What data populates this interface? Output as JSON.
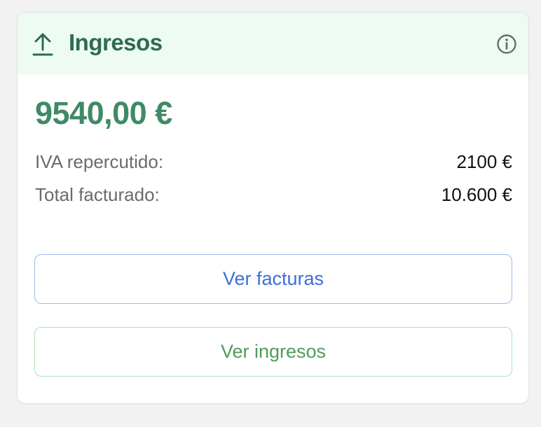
{
  "card": {
    "title": "Ingresos",
    "header_icon": "upload-icon",
    "info_icon": "info-icon",
    "net_amount": "9540,00 €",
    "rows": [
      {
        "label": "IVA repercutido:",
        "value": "2100 €"
      },
      {
        "label": "Total facturado:",
        "value": "10.600 €"
      }
    ],
    "buttons": {
      "view_invoices": "Ver facturas",
      "view_income": "Ver ingresos"
    }
  },
  "colors": {
    "header_background": "#edfbf2",
    "title": "#2f6b4f",
    "amount": "#3f8a65",
    "invoices_button_text": "#3c6fd9",
    "invoices_button_border": "#9bbcee",
    "income_button_text": "#4f9a5c",
    "income_button_border": "#a8e3b7"
  }
}
